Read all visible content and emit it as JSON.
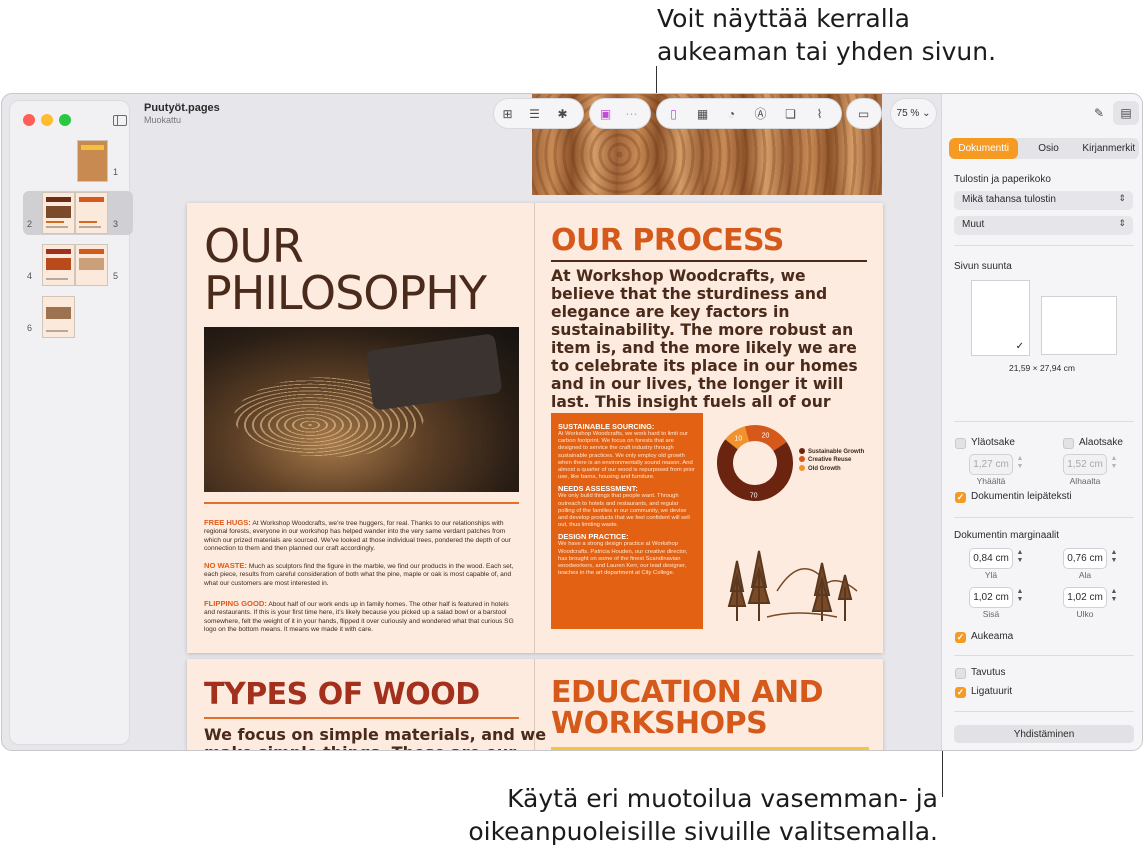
{
  "callouts": {
    "top_line1": "Voit näyttää kerralla",
    "top_line2": "aukeaman tai yhden sivun.",
    "bottom_line1": "Käytä eri muotoilua vasemman- ja",
    "bottom_line2": "oikeanpuoleisille sivuille valitsemalla."
  },
  "window": {
    "doc_title": "Puutyöt.pages",
    "doc_subtitle": "Muokattu",
    "zoom": "75 %"
  },
  "sidebar": {
    "pages": [
      {
        "num": "1"
      },
      {
        "num": "2"
      },
      {
        "num": "3"
      },
      {
        "num": "4"
      },
      {
        "num": "5"
      },
      {
        "num": "6"
      }
    ],
    "selected_pages": [
      "2",
      "3"
    ]
  },
  "toolbar_icons": [
    "add-page-icon",
    "insert-icon",
    "collaborate-icon",
    "media-icon",
    "grid-icon",
    "text-box-icon",
    "table-icon",
    "chart-icon",
    "textfield-icon",
    "shape-icon",
    "attachment-icon",
    "comment-icon"
  ],
  "document": {
    "philosophy": {
      "heading_line1": "OUR",
      "heading_line2": "PHILOSOPHY",
      "p1_title": "FREE HUGS:",
      "p1_text": "At Workshop Woodcrafts, we're tree huggers, for real. Thanks to our relationships with regional forests, everyone in our workshop has helped wander into the very same verdant patches from which our prized materials are sourced. We've looked at those individual trees, pondered the depth of our connection to them and then planned our craft accordingly.",
      "p2_title": "NO WASTE:",
      "p2_text": "Much as sculptors find the figure in the marble, we find our products in the wood. Each set, each piece, results from careful consideration of both what the pine, maple or oak is most capable of, and what our customers are most interested in.",
      "p3_title": "FLIPPING GOOD:",
      "p3_text": "About half of our work ends up in family homes. The other half is featured in hotels and restaurants. If this is your first time here, it's likely because you picked up a salad bowl or a barstool somewhere, felt the weight of it in your hands, flipped it over curiously and wondered what that curious SG logo on the bottom means. It means we made it with care."
    },
    "process": {
      "heading": "OUR PROCESS",
      "body": "At Workshop Woodcrafts, we believe that the sturdiness and elegance are key factors in sustainability. The more robust an item is, and the more likely we are to celebrate its place in our homes and in our lives, the longer it will last. This insight fuels all of our work.",
      "box": {
        "h1": "SUSTAINABLE SOURCING:",
        "t1": "At Workshop Woodcrafts, we work hard to limit our carbon footprint. We focus on forests that are designed to service the craft industry through sustainable practices. We only employ old growth when there is an environmentally sound reason. And almost a quarter of our wood is repurposed from prior use, like barns, housing and furniture.",
        "h2": "NEEDS ASSESSMENT:",
        "t2": "We only build things that people want. Through outreach to hotels and restaurants, and regular polling of the families in our community, we devise and develop products that we feel confident will sell out, thus limiting waste.",
        "h3": "DESIGN PRACTICE:",
        "t3": "We have a strong design practice at Workshop Woodcrafts. Patricia Houden, our creative director, has brought on some of the finest Scandinavian woodworkers, and Lauren Kerr, our lead designer, teaches in the art department at City College."
      }
    },
    "types": {
      "heading": "TYPES OF WOOD",
      "body_line1": "We focus on simple materials, and we",
      "body_line2": "make simple things. These are our"
    },
    "education": {
      "heading_line1": "EDUCATION AND",
      "heading_line2": "WORKSHOPS"
    }
  },
  "chart_data": {
    "type": "pie",
    "categories": [
      "Sustainable Growth",
      "Creative Reuse",
      "Old Growth"
    ],
    "values": [
      70,
      20,
      10
    ],
    "colors": [
      "#6b2410",
      "#d4591a",
      "#f0922e"
    ],
    "title": "",
    "legend": "right"
  },
  "inspector": {
    "tabs": [
      "Dokumentti",
      "Osio",
      "Kirjanmerkit"
    ],
    "active_tab": "Dokumentti",
    "printer_heading": "Tulostin ja paperikoko",
    "printer_value": "Mikä tahansa tulostin",
    "paper_value": "Muut",
    "orientation_heading": "Sivun suunta",
    "paper_size": "21,59 × 27,94 cm",
    "header_label": "Yläotsake",
    "footer_label": "Alaotsake",
    "header_value": "1,27 cm",
    "footer_value": "1,52 cm",
    "header_caption": "Yhäältä",
    "footer_caption": "Alhaalta",
    "body_label": "Dokumentin leipäteksti",
    "margins_heading": "Dokumentin marginaalit",
    "margin_top": "0,84 cm",
    "margin_bottom": "0,76 cm",
    "margin_top_caption": "Ylä",
    "margin_bottom_caption": "Ala",
    "margin_inside": "1,02 cm",
    "margin_outside": "1,02 cm",
    "margin_inside_caption": "Sisä",
    "margin_outside_caption": "Ulko",
    "facing_pages_label": "Aukeama",
    "hyphenation_label": "Tavutus",
    "ligatures_label": "Ligatuurit",
    "merge_button": "Yhdistäminen",
    "checks": {
      "header": false,
      "footer": false,
      "body": true,
      "facing_pages": true,
      "hyphenation": false,
      "ligatures": true
    }
  }
}
